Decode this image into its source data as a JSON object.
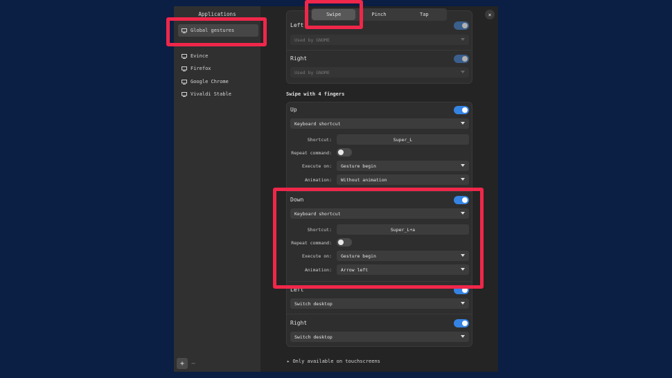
{
  "sidebar": {
    "title": "Applications",
    "apps": [
      "Global gestures",
      "Evince",
      "Firefox",
      "Google Chrome",
      "Vivaldi Stable"
    ],
    "add_label": "+",
    "remove_label": "−"
  },
  "tabs": [
    "Swipe",
    "Pinch",
    "Tap"
  ],
  "active_tab": "Swipe",
  "close_label": "×",
  "three_fingers": {
    "left": {
      "label": "Left",
      "action": "Used by GNOME",
      "enabled": true
    },
    "right": {
      "label": "Right",
      "action": "Used by GNOME",
      "enabled": true
    }
  },
  "four_fingers": {
    "title": "Swipe with 4 fingers",
    "up": {
      "label": "Up",
      "enabled": true,
      "action": "Keyboard shortcut",
      "shortcut_label": "Shortcut:",
      "shortcut": "Super_L",
      "repeat_label": "Repeat command:",
      "repeat": false,
      "execute_label": "Execute on:",
      "execute_on": "Gesture begin",
      "animation_label": "Animation:",
      "animation": "Without animation"
    },
    "down": {
      "label": "Down",
      "enabled": true,
      "action": "Keyboard shortcut",
      "shortcut_label": "Shortcut:",
      "shortcut": "Super_L+a",
      "repeat_label": "Repeat command:",
      "repeat": false,
      "execute_label": "Execute on:",
      "execute_on": "Gesture begin",
      "animation_label": "Animation:",
      "animation": "Arrow left"
    },
    "left": {
      "label": "Left",
      "enabled": true,
      "action": "Switch desktop"
    },
    "right": {
      "label": "Right",
      "enabled": true,
      "action": "Switch desktop"
    }
  },
  "footer": "Only available on touchscreens",
  "colors": {
    "accent": "#3584e4",
    "highlight": "#f0274a",
    "background": "#0b1e44"
  }
}
